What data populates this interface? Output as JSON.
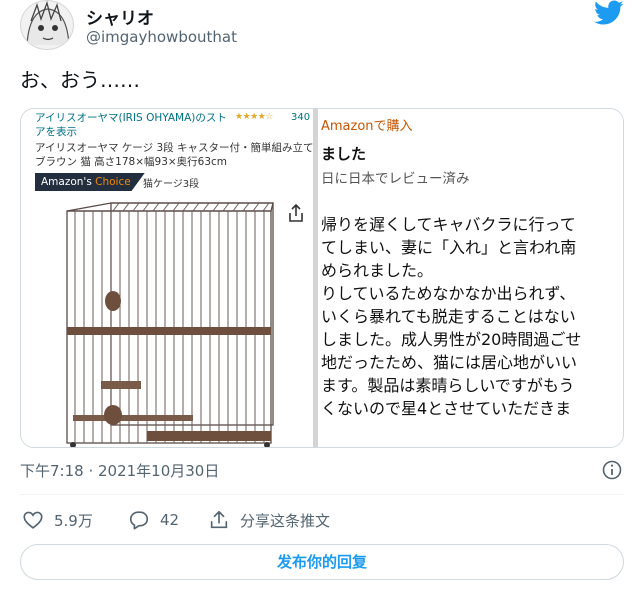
{
  "author": {
    "display_name": "シャリオ",
    "handle": "@imgayhowbouthat"
  },
  "tweet": {
    "text": "お、おう……",
    "timestamp": "下午7:18 · 2021年10月30日"
  },
  "media": {
    "product": {
      "brand_link": "アイリスオーヤマ(IRIS OHYAMA)のストアを表示",
      "rating_stars": "★★★★☆",
      "rating_count": "340",
      "title": "アイリスオーヤマ ケージ 3段 キャスター付・簡単組み立て ブラウン 猫 高さ178×幅93×奥行63cm",
      "badge_prefix": "Amazon's ",
      "badge_highlight": "Choice",
      "badge_category": "猫ケージ3段"
    },
    "review": {
      "buy_link": "Amazonで購入",
      "title": "ました",
      "meta": "日に日本でレビュー済み",
      "lines": [
        "帰りを遅くしてキャバクラに行って",
        "てしまい、妻に「入れ」と言われ南",
        "められました。",
        "りしているためなかなか出られず、",
        "いくら暴れても脱走することはない",
        "しました。成人男性が20時間過ごせ",
        "地だったため、猫には居心地がいい",
        "ます。製品は素晴らしいですがもう",
        "くないので星4とさせていただきま"
      ]
    }
  },
  "actions": {
    "likes": "5.9万",
    "replies": "42",
    "share_label": "分享这条推文",
    "reply_cta": "发布你的回复"
  },
  "icons": {
    "logo": "twitter-bird-icon",
    "info": "info-icon",
    "like": "heart-icon",
    "reply": "speech-bubble-icon",
    "share": "share-icon"
  },
  "colors": {
    "accent": "#1d9bf0",
    "text_secondary": "#536471",
    "amazon_link": "#007185",
    "amazon_orange": "#c45500"
  }
}
